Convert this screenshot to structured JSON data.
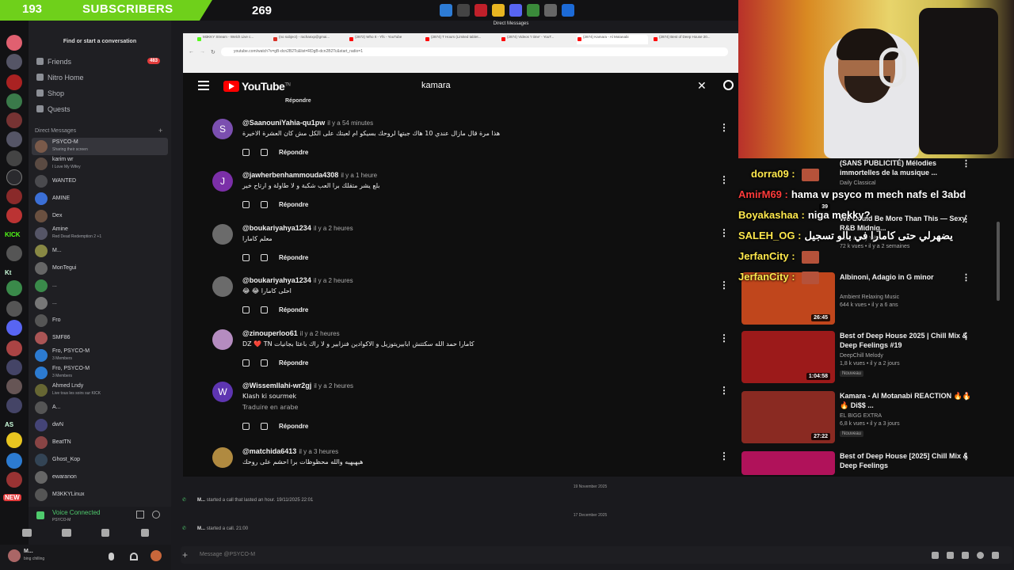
{
  "stream_overlay": {
    "subscriber_count": "193",
    "subscriber_label": "SUBSCRIBERS",
    "subscriber_goal": "269"
  },
  "discord": {
    "window_title": "Direct Messages",
    "finder_placeholder": "Find or start a conversation",
    "nav": [
      {
        "label": "Friends",
        "badge": "483",
        "icon": "friends-icon"
      },
      {
        "label": "Nitro Home",
        "icon": "nitro-icon"
      },
      {
        "label": "Shop",
        "icon": "shop-icon"
      },
      {
        "label": "Quests",
        "icon": "quests-icon"
      }
    ],
    "dm_header": "Direct Messages",
    "dms": [
      {
        "name": "PSYCO-M",
        "sub": "Sharing their screen",
        "color": "#7a5a4a"
      },
      {
        "name": "karim wr",
        "sub": "I Love My Wifey",
        "color": "#5a4a42"
      },
      {
        "name": "WANTED",
        "sub": "",
        "color": "#4a4a4e"
      },
      {
        "name": "AMINE",
        "sub": "",
        "color": "#3b6fd6"
      },
      {
        "name": "Dex",
        "sub": "",
        "color": "#6a5040"
      },
      {
        "name": "Amine",
        "sub": "Red Dead Redemption 2 +1",
        "color": "#556"
      },
      {
        "name": "M...",
        "sub": "",
        "color": "#884"
      },
      {
        "name": "MonTegui",
        "sub": "",
        "color": "#666"
      },
      {
        "name": "...",
        "sub": "",
        "color": "#3a8a4a"
      },
      {
        "name": "...",
        "sub": "",
        "color": "#777"
      },
      {
        "name": "Fro",
        "sub": "",
        "color": "#555"
      },
      {
        "name": "SMF86",
        "sub": "",
        "color": "#a55"
      },
      {
        "name": "Fro, PSYCO-M",
        "sub": "3 Members",
        "color": "#2c7bd1"
      },
      {
        "name": "Fro, PSYCO-M",
        "sub": "3 Members",
        "color": "#2c7bd1"
      },
      {
        "name": "Ahmed Lndy",
        "sub": "Live tous les soirs sur KICK",
        "color": "#663"
      },
      {
        "name": "A...",
        "sub": "",
        "color": "#555"
      },
      {
        "name": "dwN",
        "sub": "",
        "color": "#447"
      },
      {
        "name": "BeatTN",
        "sub": "",
        "color": "#844"
      },
      {
        "name": "Ghost_Kop",
        "sub": "",
        "color": "#345"
      },
      {
        "name": "ewaranon",
        "sub": "",
        "color": "#666"
      },
      {
        "name": "M3KKYLinux",
        "sub": "",
        "color": "#555"
      }
    ],
    "voice_status": "Voice Connected",
    "voice_channel": "PSYCO-M",
    "user_name": "M...",
    "user_status": "bing chilling",
    "date_sep_1": "19 November 2025",
    "call_1_user": "M...",
    "call_1_text": "started a call that lasted an hour. 19/11/2025 22:01",
    "date_sep_2": "17 December 2025",
    "call_2_user": "M...",
    "call_2_text": "started a call. 21:00",
    "message_placeholder": "Message @PSYCO-M"
  },
  "browser": {
    "tabs": [
      "M3KKY Stream - Welch Live c...",
      "(no subject) - rachanxp@gmai...",
      "(2872) Who It - Yfs - YouTube",
      "(2874) T Hours (Limited tablet...",
      "(2874) Videos 'I time' - YouT...",
      "(2874) Kamara - Al Motanabi",
      "(2874) Best of Deep House 20..."
    ],
    "url": "youtube.com/watch?v=gB-dcn2B2Tc&list=RDgB-dcn2B2Tc&start_radio=1"
  },
  "youtube": {
    "logo_text": "YouTube",
    "logo_sup": "TN",
    "search_value": "kamara",
    "top_reply_label": "Répondre",
    "comments": [
      {
        "avatar_letter": "S",
        "avatar_color": "#7b4fb0",
        "user": "@SaanouniYahia-qu1pw",
        "time": "il y a 54 minutes",
        "text": "هذا مرة قال مازال عندي 10 هاك جبتها لروحك بسيكو ام لعبتك على الكل مش كان العشرة الاخيرة",
        "text2": "",
        "reply": "Répondre"
      },
      {
        "avatar_letter": "J",
        "avatar_color": "#7b2fa8",
        "user": "@jawherbenhammouda4308",
        "time": "il y a 1 heure",
        "text": "بلع يشر متقلك برا العب شكبة و لا طاولة و ارتاح خير",
        "text2": "",
        "reply": "Répondre"
      },
      {
        "avatar_letter": "",
        "avatar_color": "#6b6b6b",
        "user": "@boukariyahya1234",
        "time": "il y a 2 heures",
        "text": "معلم كامارا",
        "text2": "",
        "reply": "Répondre"
      },
      {
        "avatar_letter": "",
        "avatar_color": "#6b6b6b",
        "user": "@boukariyahya1234",
        "time": "il y a 2 heures",
        "text": "😂 😂 احلى كامارا",
        "text2": "",
        "reply": "Répondre"
      },
      {
        "avatar_letter": "",
        "avatar_color": "#b58cc0",
        "user": "@zinouperloo61",
        "time": "il y a 2 heures",
        "text": "DZ ❤️ TN كامارا حمد الله سكتتش ابابيريتوزيل و الاكوادين فنزابير و لا راك باعثا بجانيات",
        "text2": "",
        "reply": "Répondre"
      },
      {
        "avatar_letter": "W",
        "avatar_color": "#5e35b1",
        "user": "@Wissemllahi-wr2gj",
        "time": "il y a 2 heures",
        "text": "Klash  ki sourmek",
        "text2": "Traduire en arabe",
        "reply": "Répondre"
      },
      {
        "avatar_letter": "",
        "avatar_color": "#b08a40",
        "user": "@matchida6413",
        "time": "il y a 3 heures",
        "text": "هيهيهيه والله محظوظات برا احشم على روحك",
        "text2": "",
        "reply": ""
      }
    ],
    "related": [
      {
        "title": "(SANS PUBLICITÉ) Mélodies immortelles de la musique ...",
        "channel": "Daily Classical",
        "meta": "",
        "duration": "",
        "new": "",
        "thumb": "#2e2a24"
      },
      {
        "title": "We Could Be More Than This — Sexy R&B Midnig...",
        "channel": "Lock & Key Vibes",
        "meta": "72 k vues • il y a 2 semaines",
        "duration": "39",
        "new": "",
        "thumb": "#3a2a2a"
      },
      {
        "title": "Albinoni, Adagio in G minor",
        "channel": "Ambient Relaxing Music",
        "meta": "644 k vues • il y a 6 ans",
        "duration": "26:45",
        "new": "",
        "thumb": "#c0461c"
      },
      {
        "title": "Best of Deep House 2025 | Chill Mix & Deep Feelings #19",
        "channel": "DeepChill Melody",
        "meta": "1,8 k vues • il y a 2 jours",
        "duration": "1:04:58",
        "new": "Nouveau",
        "thumb": "#9c1a1a"
      },
      {
        "title": "Kamara - Al Motanabi REACTION 🔥🔥🔥 Di$$ ...",
        "channel": "EL BIGG EXTRA",
        "meta": "6,8 k vues • il y a 3 jours",
        "duration": "27:22",
        "new": "Nouveau",
        "thumb": "#8a2a22"
      },
      {
        "title": "Best of Deep House [2025] Chill Mix & Deep Feelings",
        "channel": "",
        "meta": "",
        "duration": "",
        "new": "",
        "thumb": "#b0125a"
      }
    ]
  },
  "stream_chat": [
    {
      "user": "dorra09 :",
      "msg": ""
    },
    {
      "user": "AmirM69 :",
      "msg": "hama w psyco m mech nafs el 3abd"
    },
    {
      "user": "Boyakashaa :",
      "msg": "niga mekky?"
    },
    {
      "user": "SALEH_OG :",
      "msg": "يضهرلي حتى كامارا في بالو تسجيل"
    },
    {
      "user": "JerfanCity :",
      "msg": ""
    },
    {
      "user": "JerfanCity :",
      "msg": ""
    }
  ],
  "server_labels": [
    "KICK",
    "Kt",
    "AS",
    "NEW"
  ],
  "colors": {
    "discord_bg": "#1f1f23",
    "youtube_red": "#ff0000",
    "sub_green": "#6fd01b",
    "chat_user": "#ffe94d"
  }
}
